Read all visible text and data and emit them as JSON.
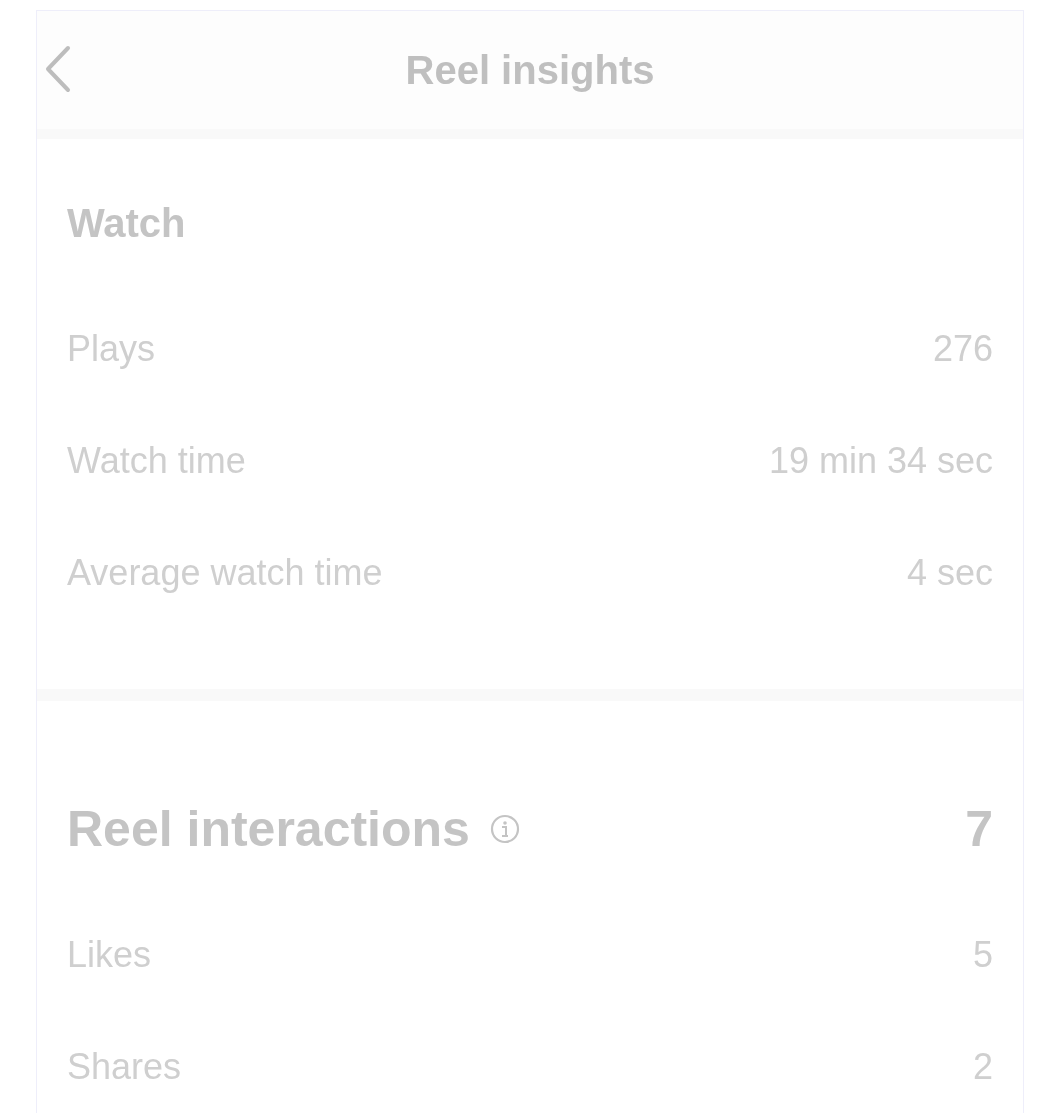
{
  "header": {
    "title": "Reel insights"
  },
  "sections": [
    {
      "title": "Watch",
      "kind": "plain",
      "rows": [
        {
          "label": "Plays",
          "value": "276"
        },
        {
          "label": "Watch time",
          "value": "19 min 34 sec"
        },
        {
          "label": "Average watch time",
          "value": "4 sec"
        }
      ]
    },
    {
      "title": "Reel interactions",
      "kind": "total",
      "total": "7",
      "rows": [
        {
          "label": "Likes",
          "value": "5"
        },
        {
          "label": "Shares",
          "value": "2"
        }
      ]
    }
  ]
}
